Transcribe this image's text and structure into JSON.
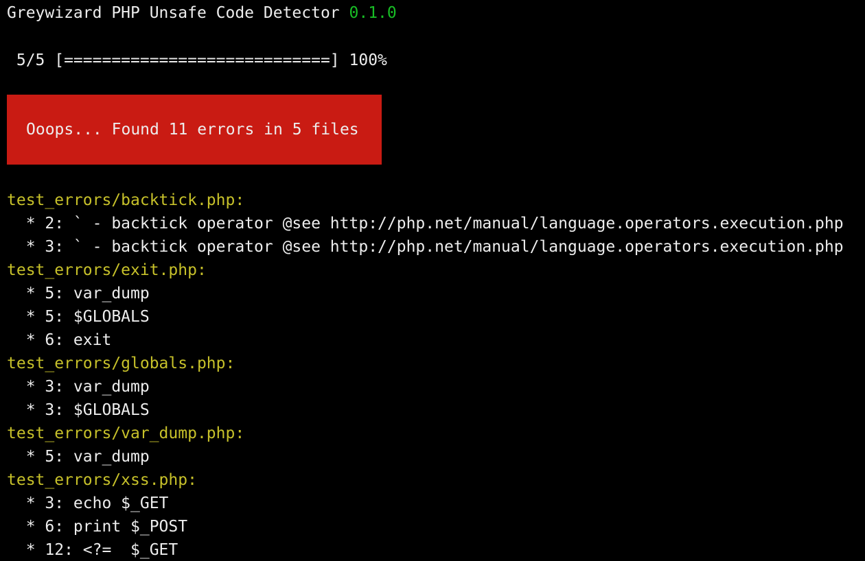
{
  "header": {
    "title": "Greywizard PHP Unsafe Code Detector ",
    "version": "0.1.0"
  },
  "progress": {
    "text": " 5/5 [============================] 100%",
    "completed": 5,
    "total": 5,
    "percent": 100
  },
  "banner": {
    "message": "Ooops... Found 11 errors in 5 files",
    "error_count": 11,
    "file_count": 5
  },
  "colors": {
    "background": "#000000",
    "text": "#ededed",
    "version": "#18bd25",
    "banner_bg": "#c91b13",
    "filename": "#c7c12a"
  },
  "results": [
    {
      "file": "test_errors/backtick.php:",
      "entries": [
        "  * 2: ` - backtick operator @see http://php.net/manual/language.operators.execution.php",
        "  * 3: ` - backtick operator @see http://php.net/manual/language.operators.execution.php"
      ]
    },
    {
      "file": "test_errors/exit.php:",
      "entries": [
        "  * 5: var_dump",
        "  * 5: $GLOBALS",
        "  * 6: exit"
      ]
    },
    {
      "file": "test_errors/globals.php:",
      "entries": [
        "  * 3: var_dump",
        "  * 3: $GLOBALS"
      ]
    },
    {
      "file": "test_errors/var_dump.php:",
      "entries": [
        "  * 5: var_dump"
      ]
    },
    {
      "file": "test_errors/xss.php:",
      "entries": [
        "  * 3: echo $_GET",
        "  * 6: print $_POST",
        "  * 12: <?=  $_GET"
      ]
    }
  ]
}
